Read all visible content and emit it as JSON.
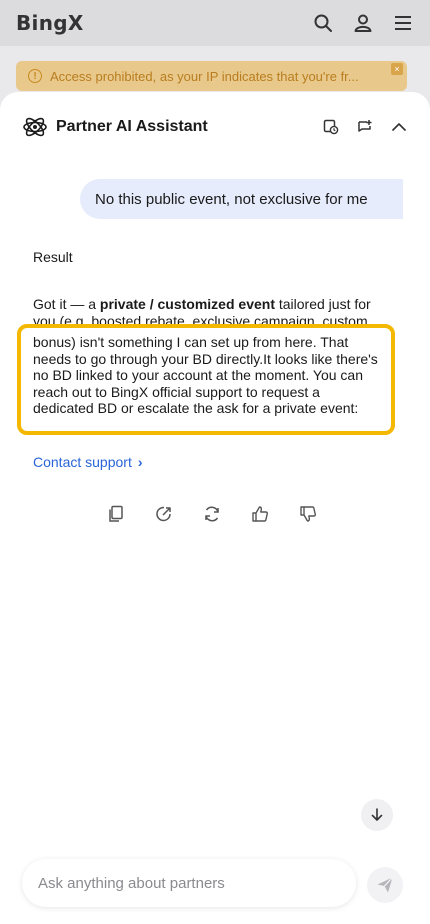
{
  "app": {
    "logo": "BingX"
  },
  "banner": {
    "text": "Access prohibited, as your IP indicates that you're fr..."
  },
  "assistant": {
    "title": "Partner AI Assistant"
  },
  "chat": {
    "user_message": "No this public event, not exclusive for me",
    "result_label": "Result",
    "answer_prefix": "Got it — a ",
    "answer_bold": "private / customized event",
    "answer_suffix": " tailored just for you (e.g. boosted rebate, exclusive campaign, custom",
    "answer_highlight": "bonus) isn't something I can set up from here. That needs to go through your BD directly.It looks like there's no BD linked to your account at the moment. You can reach out to BingX official support to request a dedicated BD or escalate the ask for a private event:",
    "contact_label": "Contact support"
  },
  "input": {
    "placeholder": "Ask anything about partners"
  },
  "colors": {
    "accent": "#2965d8",
    "highlight_border": "#f5b800",
    "user_bubble": "#e6ecfb",
    "warning_bg": "#e9c98b"
  }
}
